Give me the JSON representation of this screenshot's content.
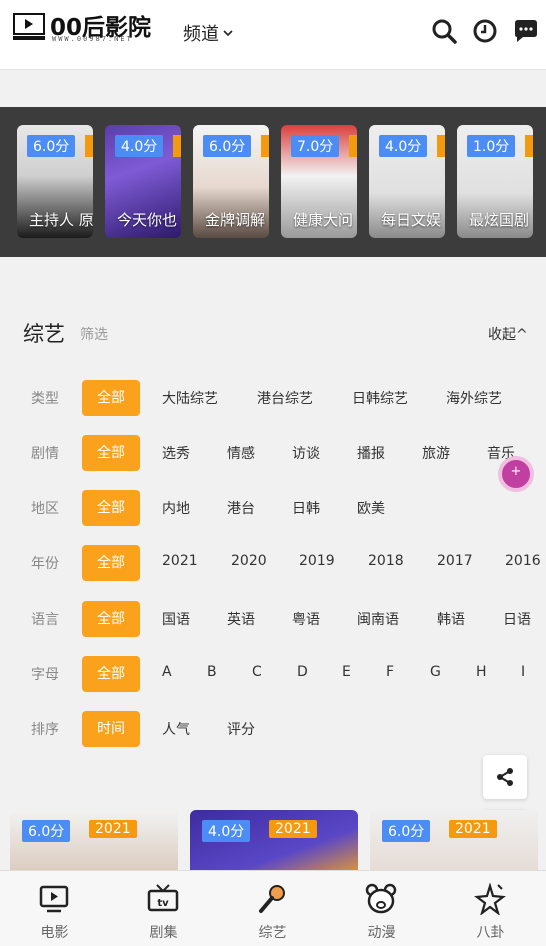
{
  "header": {
    "logo_text": "00后影院",
    "logo_sub": "WWW.00987.NET",
    "channel_label": "频道"
  },
  "carousel": [
    {
      "score": "6.0分",
      "title": "主持人 原"
    },
    {
      "score": "4.0分",
      "title": "今天你也"
    },
    {
      "score": "6.0分",
      "title": "金牌调解"
    },
    {
      "score": "7.0分",
      "title": "健康大问"
    },
    {
      "score": "4.0分",
      "title": "每日文娱"
    },
    {
      "score": "1.0分",
      "title": "最炫国剧"
    }
  ],
  "filter": {
    "title": "综艺",
    "filter_label": "筛选",
    "collapse_label": "收起",
    "rows": [
      {
        "label": "类型",
        "options": [
          "全部",
          "大陆综艺",
          "港台综艺",
          "日韩综艺",
          "海外综艺"
        ]
      },
      {
        "label": "剧情",
        "options": [
          "全部",
          "选秀",
          "情感",
          "访谈",
          "播报",
          "旅游",
          "音乐"
        ]
      },
      {
        "label": "地区",
        "options": [
          "全部",
          "内地",
          "港台",
          "日韩",
          "欧美"
        ]
      },
      {
        "label": "年份",
        "options": [
          "全部",
          "2021",
          "2020",
          "2019",
          "2018",
          "2017",
          "2016"
        ]
      },
      {
        "label": "语言",
        "options": [
          "全部",
          "国语",
          "英语",
          "粤语",
          "闽南语",
          "韩语",
          "日语"
        ]
      },
      {
        "label": "字母",
        "options": [
          "全部",
          "A",
          "B",
          "C",
          "D",
          "E",
          "F",
          "G",
          "H",
          "I"
        ]
      },
      {
        "label": "排序",
        "options": [
          "时间",
          "人气",
          "评分"
        ]
      }
    ]
  },
  "posters": [
    {
      "score": "6.0分",
      "year": "2021"
    },
    {
      "score": "4.0分",
      "year": "2021"
    },
    {
      "score": "6.0分",
      "year": "2021"
    }
  ],
  "nav": [
    {
      "label": "电影",
      "icon": "movie-icon"
    },
    {
      "label": "剧集",
      "icon": "tv-icon"
    },
    {
      "label": "综艺",
      "icon": "microphone-icon"
    },
    {
      "label": "动漫",
      "icon": "bear-icon"
    },
    {
      "label": "八卦",
      "icon": "sparkle-icon"
    }
  ],
  "colors": {
    "accent": "#fba21c",
    "score_badge": "#4c8df5",
    "carousel_bg": "#3c3c3c"
  }
}
